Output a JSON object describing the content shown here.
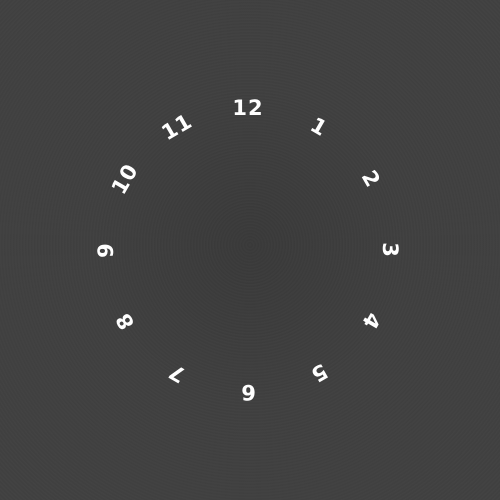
{
  "clock_face": {
    "numerals": [
      "12",
      "1",
      "2",
      "3",
      "4",
      "5",
      "6",
      "7",
      "8",
      "9",
      "10",
      "11"
    ],
    "text_color": "#ffffff",
    "background_color": "#3f3f3f"
  }
}
